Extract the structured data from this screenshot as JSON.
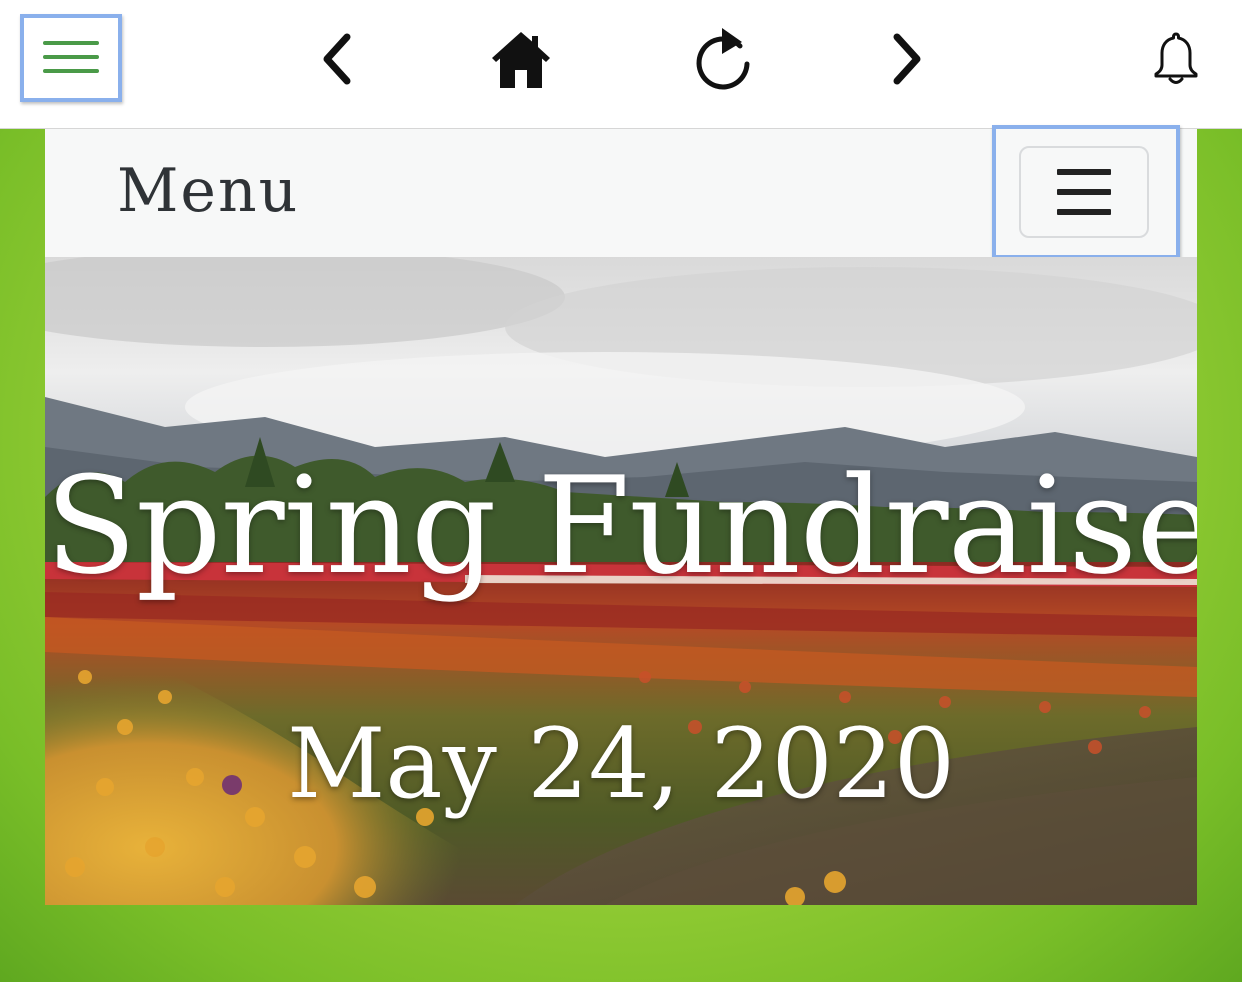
{
  "toolbar": {
    "buttons": [
      {
        "icon": "hamburger-icon",
        "color": "#4a9a48"
      },
      {
        "icon": "chevron-left-icon"
      },
      {
        "icon": "home-icon"
      },
      {
        "icon": "reload-icon"
      },
      {
        "icon": "chevron-right-icon"
      },
      {
        "icon": "bell-icon"
      }
    ],
    "highlight_color": "#8ab0ec"
  },
  "navbar": {
    "brand": "Menu",
    "toggle_icon": "hamburger-icon"
  },
  "hero": {
    "title": "Spring Fundraiser",
    "date": "May 24, 2020",
    "image": "tulip-field-photo"
  },
  "colors": {
    "page_background": "#9fd23a",
    "navbar_background": "#f7f8f8",
    "brand_text": "#2f3337",
    "hero_text": "#ffffff"
  }
}
